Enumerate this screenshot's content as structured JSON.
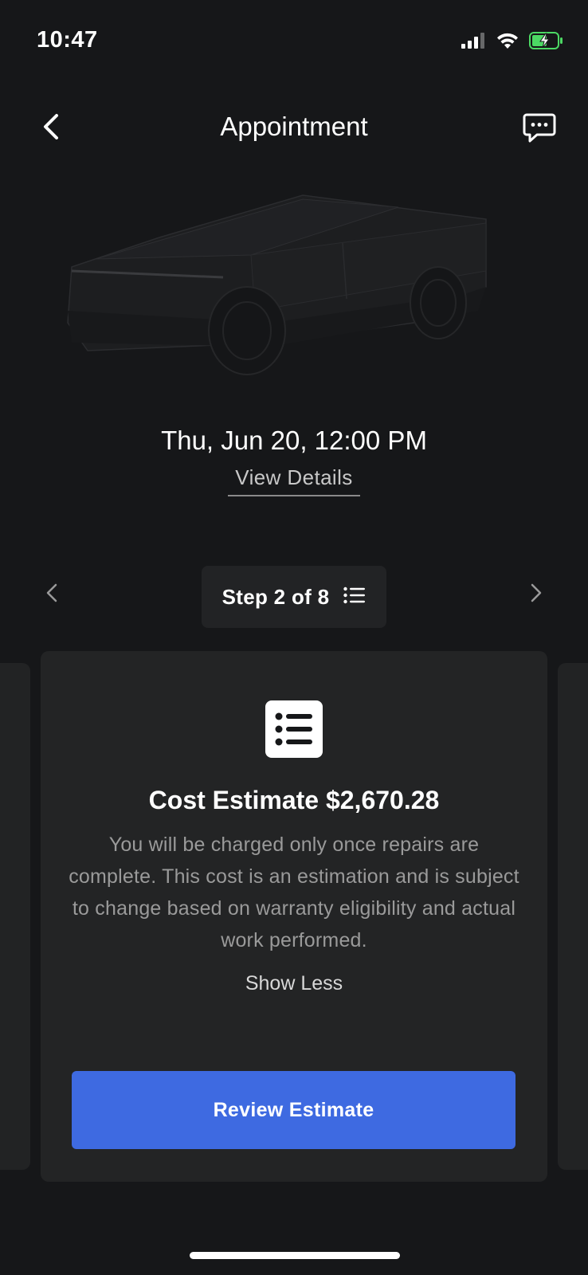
{
  "status_bar": {
    "time": "10:47",
    "icons": [
      "signal-icon",
      "wifi-icon",
      "battery-charging-icon"
    ]
  },
  "header": {
    "title": "Appointment",
    "back_icon": "chevron-left-icon",
    "chat_icon": "chat-bubble-icon"
  },
  "appointment": {
    "date_time": "Thu, Jun 20, 12:00 PM",
    "view_details_label": "View Details"
  },
  "step_nav": {
    "label": "Step 2 of 8",
    "list_icon": "list-icon",
    "prev_icon": "chevron-left-icon",
    "next_icon": "chevron-right-icon"
  },
  "card": {
    "icon": "list-icon",
    "title": "Cost Estimate $2,670.28",
    "body": "You will be charged only once repairs are complete. This cost is an estimation and is subject to change based on warranty eligibility and actual work performed.",
    "show_less_label": "Show Less",
    "button_label": "Review Estimate"
  },
  "colors": {
    "background": "#161719",
    "card": "#232425",
    "accent": "#3e6ae1",
    "battery_green": "#4cd964"
  }
}
